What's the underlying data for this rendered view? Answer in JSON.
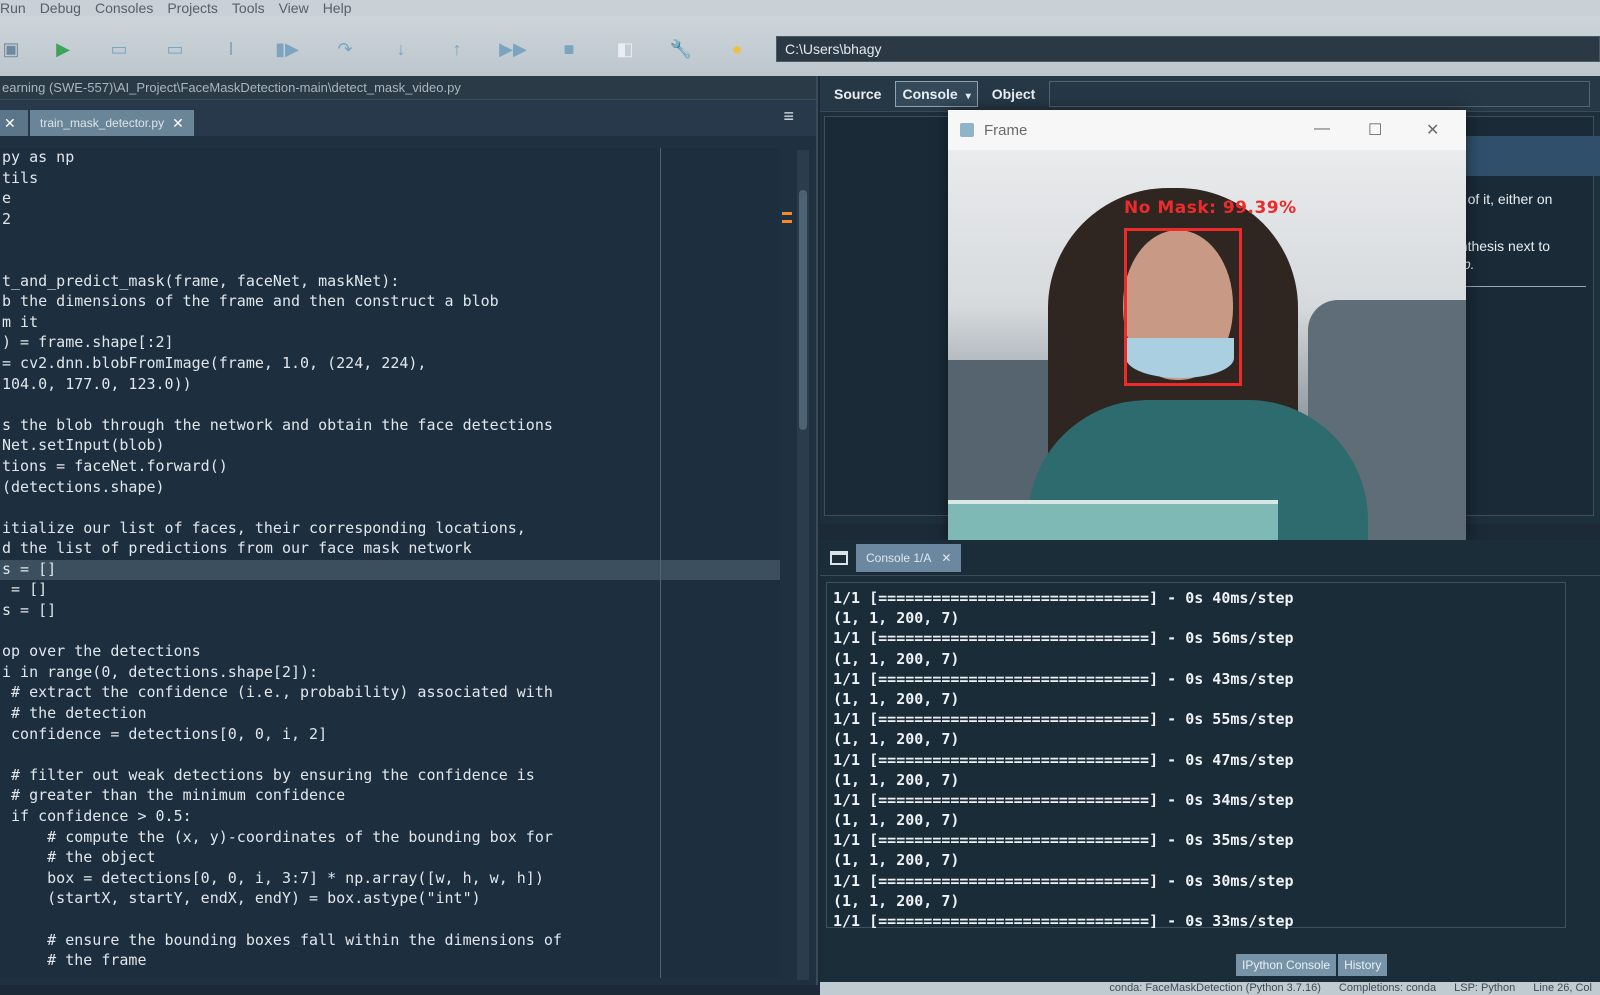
{
  "menu": [
    "Run",
    "Debug",
    "Consoles",
    "Projects",
    "Tools",
    "View",
    "Help"
  ],
  "toolbar": {
    "path": "C:\\Users\\bhagy",
    "icons": [
      "save-icon",
      "run-icon",
      "run-cell-icon",
      "run-cell-advance-icon",
      "run-selection-icon",
      "debug-icon",
      "step-over-icon",
      "step-into-icon",
      "step-out-icon",
      "continue-icon",
      "stop-icon",
      "maximize-pane-icon",
      "preferences-icon",
      "python-path-icon"
    ]
  },
  "editor": {
    "filepath": "earning (SWE-557)\\AI_Project\\FaceMaskDetection-main\\detect_mask_video.py",
    "tabs": [
      {
        "label": "",
        "close": "✕"
      },
      {
        "label": "train_mask_detector.py",
        "close": "✕"
      }
    ],
    "menu_icon": "≡"
  },
  "code": [
    {
      "t": "py as np"
    },
    {
      "t": "tils"
    },
    {
      "t": "e"
    },
    {
      "t": "2"
    },
    {
      "t": ""
    },
    {
      "t": ""
    },
    {
      "t": "t_and_predict_mask(frame, faceNet, maskNet):"
    },
    {
      "t": "b the dimensions of the frame and then construct a blob"
    },
    {
      "t": "m it"
    },
    {
      "t": ") = frame.shape[:2]"
    },
    {
      "t": "= cv2.dnn.blobFromImage(frame, 1.0, (224, 224),"
    },
    {
      "t": "104.0, 177.0, 123.0))"
    },
    {
      "t": ""
    },
    {
      "t": "s the blob through the network and obtain the face detections"
    },
    {
      "t": "Net.setInput(blob)"
    },
    {
      "t": "tions = faceNet.forward()"
    },
    {
      "t": "(detections.shape)"
    },
    {
      "t": ""
    },
    {
      "t": "itialize our list of faces, their corresponding locations,"
    },
    {
      "t": "d the list of predictions from our face mask network"
    },
    {
      "t": "s = []"
    },
    {
      "t": " = []"
    },
    {
      "t": "s = []"
    },
    {
      "t": ""
    },
    {
      "t": "op over the detections"
    },
    {
      "t": "i in range(0, detections.shape[2]):"
    },
    {
      "t": " # extract the confidence (i.e., probability) associated with"
    },
    {
      "t": " # the detection"
    },
    {
      "t": " confidence = detections[0, 0, i, 2]"
    },
    {
      "t": ""
    },
    {
      "t": " # filter out weak detections by ensuring the confidence is"
    },
    {
      "t": " # greater than the minimum confidence"
    },
    {
      "t": " if confidence > 0.5:"
    },
    {
      "t": "     # compute the (x, y)-coordinates of the bounding box for"
    },
    {
      "t": "     # the object"
    },
    {
      "t": "     box = detections[0, 0, i, 3:7] * np.array([w, h, w, h])"
    },
    {
      "t": "     (startX, startY, endX, endY) = box.astype(\"int\")"
    },
    {
      "t": ""
    },
    {
      "t": "     # ensure the bounding boxes fall within the dimensions of"
    },
    {
      "t": "     # the frame"
    }
  ],
  "right_pane": {
    "tabs": [
      "Source",
      "Console",
      "Object"
    ],
    "help_text_1": "nt of it, either on",
    "help_text_2": "enthesis next to",
    "help_text_3": "elp."
  },
  "frame_window": {
    "title": "Frame",
    "minimize": "—",
    "maximize": "☐",
    "close": "✕",
    "detection_label": "No Mask: 99.39%"
  },
  "console": {
    "tab_label": "Console 1/A",
    "tab_close": "✕",
    "lines": [
      "1/1 [==============================] - 0s 40ms/step",
      "(1, 1, 200, 7)",
      "1/1 [==============================] - 0s 56ms/step",
      "(1, 1, 200, 7)",
      "1/1 [==============================] - 0s 43ms/step",
      "(1, 1, 200, 7)",
      "1/1 [==============================] - 0s 55ms/step",
      "(1, 1, 200, 7)",
      "1/1 [==============================] - 0s 47ms/step",
      "(1, 1, 200, 7)",
      "1/1 [==============================] - 0s 34ms/step",
      "(1, 1, 200, 7)",
      "1/1 [==============================] - 0s 35ms/step",
      "(1, 1, 200, 7)",
      "1/1 [==============================] - 0s 30ms/step",
      "(1, 1, 200, 7)",
      "1/1 [==============================] - 0s 33ms/step"
    ],
    "bottom_tabs": [
      "IPython Console",
      "History"
    ]
  },
  "status": [
    "conda: FaceMaskDetection (Python 3.7.16)",
    "Completions: conda",
    "LSP: Python",
    "Line 26, Col"
  ],
  "colors": {
    "bbox": "#ee2a2a",
    "editor_bg": "#1d2f3e",
    "keyword": "#ba8be0",
    "function": "#4cc5ef",
    "number": "#f2c36b"
  }
}
